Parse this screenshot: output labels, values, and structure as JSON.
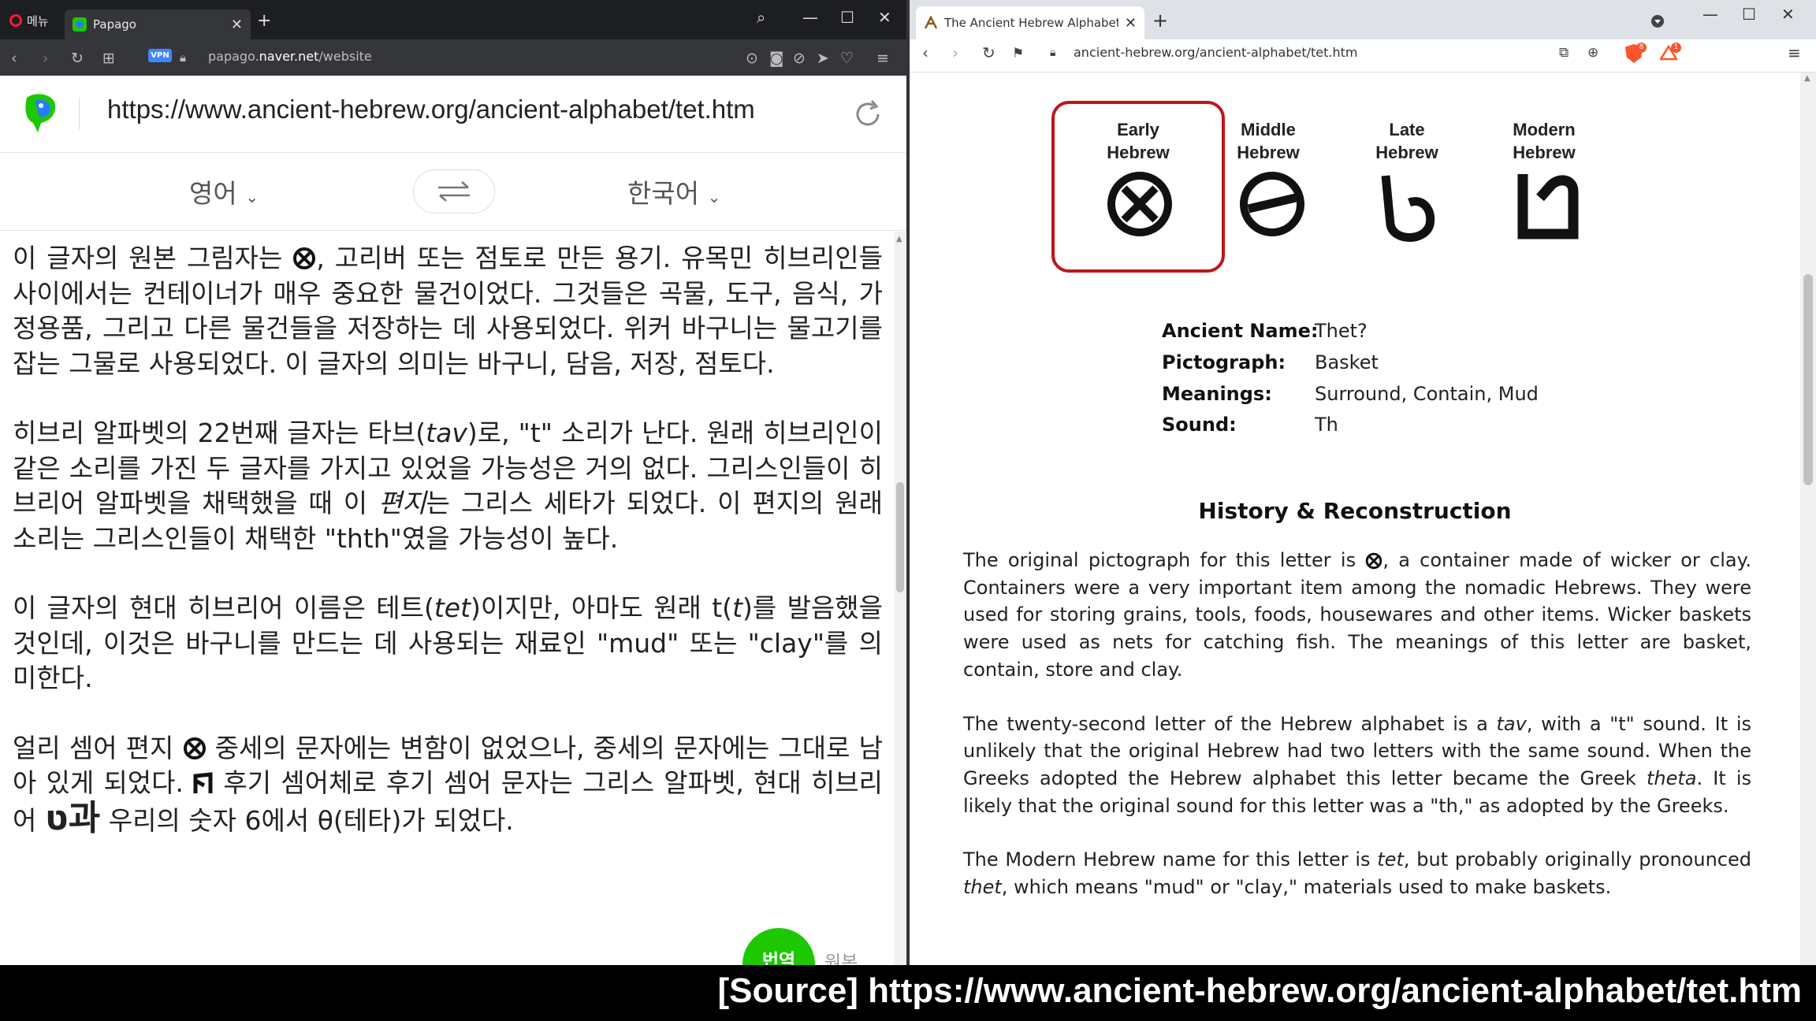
{
  "left_window": {
    "menu_label": "메뉴",
    "tab_title": "Papago",
    "new_tab": "+",
    "address": {
      "host_prefix": "papago.",
      "host_bold": "naver.net",
      "path": "/website",
      "vpn": "VPN"
    },
    "papago": {
      "url_value": "https://www.ancient-hebrew.org/ancient-alphabet/tet.htm",
      "source_lang": "영어",
      "target_lang": "한국어",
      "translate_button": "번역",
      "original_button": "원본",
      "paragraphs": {
        "p1_a": "이 글자의 원본 그림자는 ",
        "p1_b": ", 고리버 또는 점토로 만든 용기. 유목민 히브리인들 사이에서는 컨테이너가 매우 중요한 물건이었다. 그것들은 곡물, 도구, 음식, 가정용품, 그리고 다른 물건들을 저장하는 데 사용되었다. 위커 바구니는 물고기를 잡는 그물로 사용되었다. 이 글자의 의미는 바구니, 담음, 저장, 점토다.",
        "p2_a": "히브리 알파벳의 22번째 글자는 타브(",
        "p2_tav": "tav",
        "p2_b": ")로, \"t\" 소리가 난다. 원래 히브리인이 같은 소리를 가진 두 글자를 가지고 있었을 가능성은 거의 없다. 그리스인들이 히브리어 알파벳을 채택했을 때 이 ",
        "p2_letter": "편지",
        "p2_c": "는 그리스 세타가 되었다. 이 편지의 원래 소리는 그리스인들이 채택한 \"thth\"였을 가능성이 높다.",
        "p3_a": "이 글자의 현대 히브리어 이름은 테트(",
        "p3_tet": "tet",
        "p3_b": ")이지만, 아마도 원래 t(",
        "p3_t": "t",
        "p3_c": ")를 발음했을 것인데, 이것은 바구니를 만드는 데 사용되는 재료인 \"mud\" 또는 \"clay\"를 의미한다.",
        "p4_a": "얼리 셈어 편지 ",
        "p4_b": " 중세의 문자에는 변함이 없었으나, 중세의 문자에는 그대로 남아 있게 되었다. ",
        "p4_c": " 후기 셈어체로 후기 셈어 문자는 그리스 알파벳, 현대 히브리어 ",
        "p4_glyph": "ט과",
        "p4_d": " 우리의 숫자 6에서 θ(테타)가 되었다."
      }
    }
  },
  "right_window": {
    "tab_title": "The Ancient Hebrew Alphabet | A",
    "url": "ancient-hebrew.org/ancient-alphabet/tet.htm",
    "shield_count": "8",
    "rewards_count": "1",
    "letters": [
      {
        "label_1": "Early",
        "label_2": "Hebrew",
        "icon": "circle-x-pictograph"
      },
      {
        "label_1": "Middle",
        "label_2": "Hebrew",
        "icon": "middle-tet"
      },
      {
        "label_1": "Late",
        "label_2": "Hebrew",
        "icon": "late-tet"
      },
      {
        "label_1": "Modern",
        "label_2": "Hebrew",
        "icon": "modern-tet"
      }
    ],
    "info": [
      {
        "key": "Ancient Name:",
        "value": "Thet?"
      },
      {
        "key": "Pictograph:",
        "value": "Basket"
      },
      {
        "key": "Meanings:",
        "value": "Surround, Contain, Mud"
      },
      {
        "key": "Sound:",
        "value": "Th"
      }
    ],
    "history_title": "History & Reconstruction",
    "history": {
      "p1_a": "The original pictograph for this letter is ",
      "p1_b": ", a container made of wicker or clay. Containers were a very important item among the nomadic Hebrews. They were used for storing grains, tools, foods, housewares and other items. Wicker baskets were used as nets for catching fish. The meanings of this letter are basket, contain, store and clay.",
      "p2_a": "The twenty-second letter of the Hebrew alphabet is a ",
      "p2_tav": "tav",
      "p2_b": ", with a \"t\" sound. It is unlikely that the original Hebrew had two letters with the same sound. When the Greeks adopted the Hebrew alphabet this letter became the Greek ",
      "p2_theta": "theta",
      "p2_c": ". It is likely that the original sound for this letter was a \"th,\" as adopted by the Greeks.",
      "p3_a": "The Modern Hebrew name for this letter is ",
      "p3_tet": "tet",
      "p3_b": ", but probably originally pronounced ",
      "p3_thet": "thet",
      "p3_c": ", which means \"mud\" or \"clay,\" materials used to make baskets."
    }
  },
  "caption": "[Source]  https://www.ancient-hebrew.org/ancient-alphabet/tet.htm"
}
